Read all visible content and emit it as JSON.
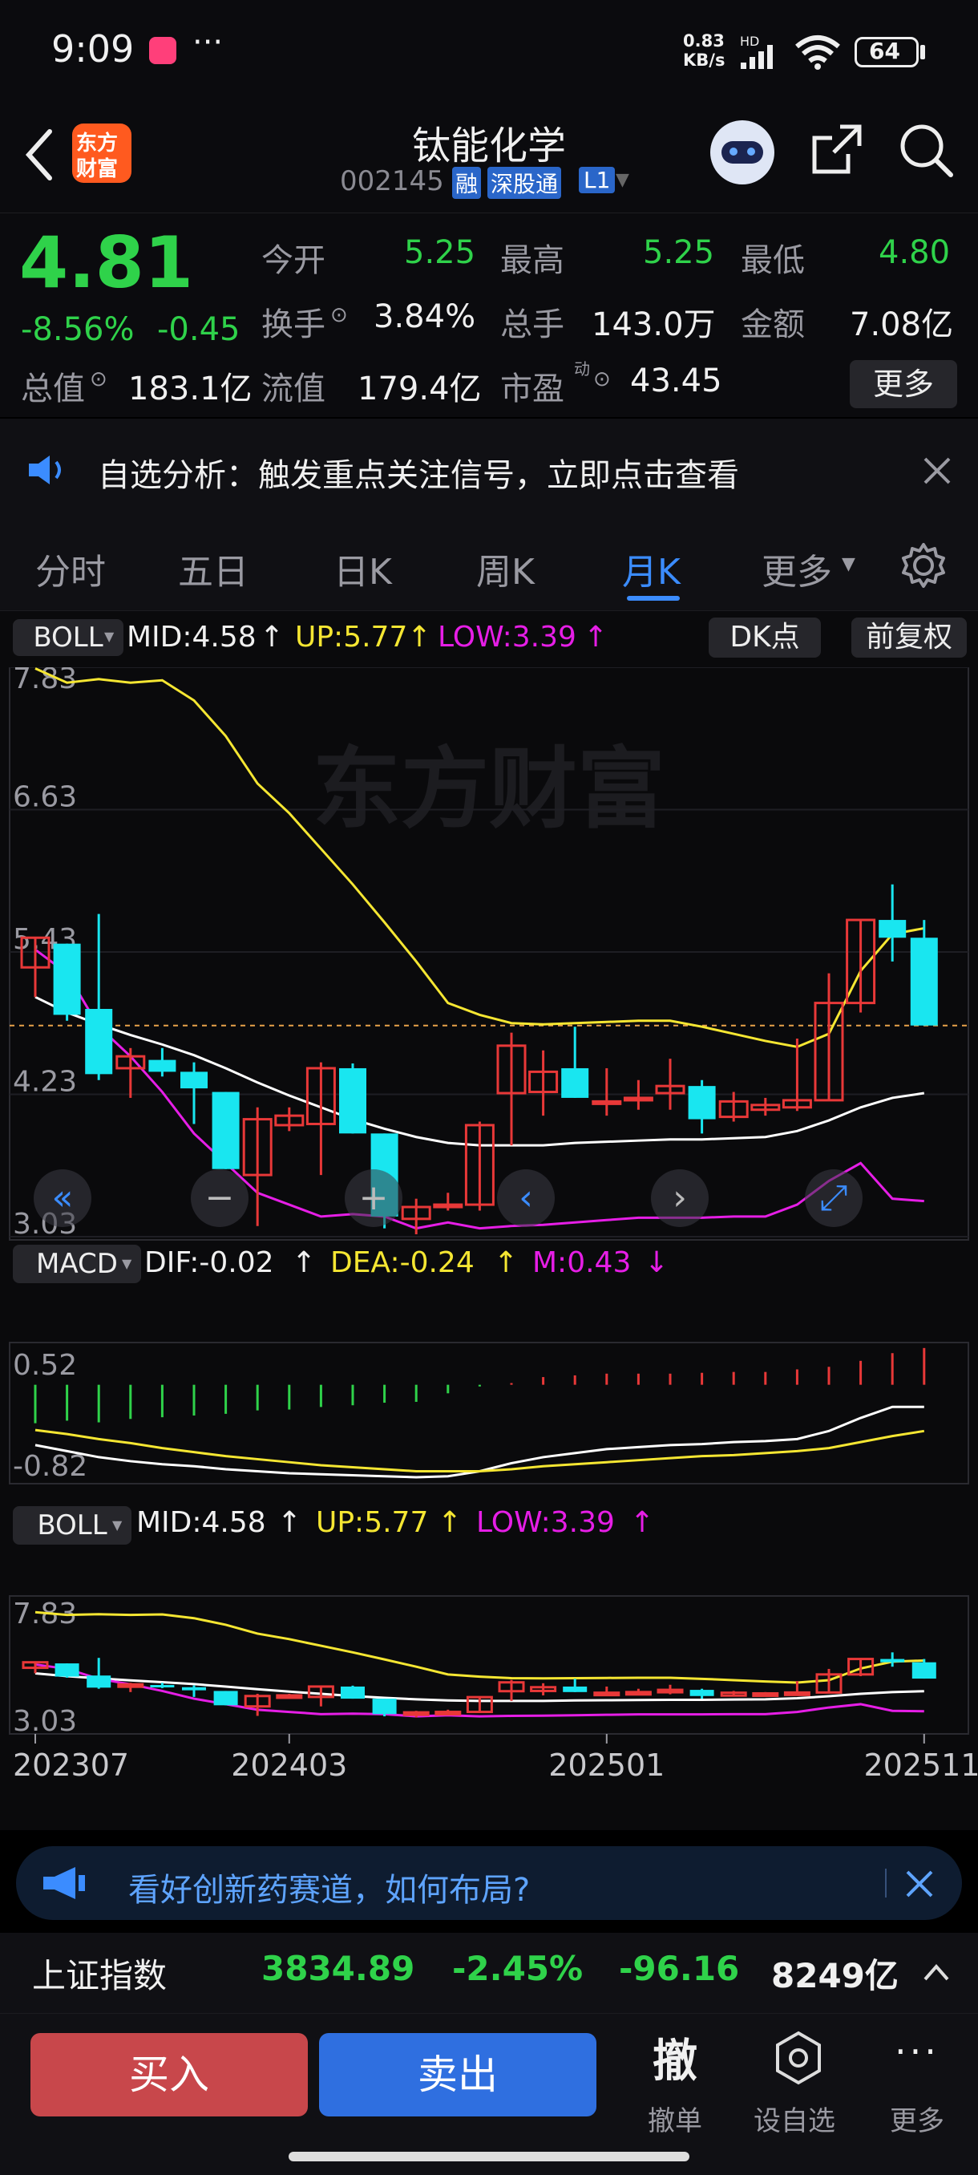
{
  "status": {
    "time": "9:09",
    "dots": "···",
    "net_speed_value": "0.83",
    "net_speed_unit": "KB/s",
    "net_type": "HD",
    "battery": "64"
  },
  "header": {
    "title": "钛能化学",
    "code": "002145",
    "tags": [
      "融",
      "深股通",
      "L1"
    ],
    "logo_text_1": "东方",
    "logo_text_2": "财富"
  },
  "quote": {
    "price": "4.81",
    "change_pct": "-8.56%",
    "change": "-0.45",
    "open_label": "今开",
    "open": "5.25",
    "high_label": "最高",
    "high": "5.25",
    "low_label": "最低",
    "low": "4.80",
    "turnover_label": "换手",
    "turnover": "3.84%",
    "volume_label": "总手",
    "volume": "143.0万",
    "amount_label": "金额",
    "amount": "7.08亿",
    "mcap_label": "总值",
    "mcap": "183.1亿",
    "float_label": "流值",
    "float": "179.4亿",
    "pe_label": "市盈",
    "pe_sup": "动",
    "pe": "43.45",
    "more": "更多"
  },
  "notice": {
    "text": "自选分析：触发重点关注信号，立即点击查看"
  },
  "tabs": [
    "分时",
    "五日",
    "日K",
    "周K",
    "月K",
    "更多"
  ],
  "active_tab": "月K",
  "chart": {
    "boll": {
      "name": "BOLL",
      "mid": "MID:4.58",
      "up": "UP:5.77",
      "low": "LOW:3.39",
      "arrow": "↑"
    },
    "dk_button": "DK点",
    "fq_button": "前复权",
    "watermark": "东方财富",
    "macd": {
      "name": "MACD",
      "dif": "DIF:-0.02",
      "dea": "DEA:-0.24",
      "m": "M:0.43",
      "up": "↑",
      "down": "↓"
    },
    "macd_axis": [
      "0.52",
      "-0.82"
    ],
    "x_labels": [
      "202307",
      "202403",
      "202501",
      "202511"
    ],
    "colors": {
      "up": "#e83838",
      "down": "#19e6f0",
      "mid": "#ffffff",
      "upper": "#f5e632",
      "lower": "#e61ee6",
      "macd_pos": "#e83838",
      "macd_neg": "#2fd24a"
    }
  },
  "chart_data": {
    "type": "candlestick",
    "y_ticks": [
      "7.83",
      "6.63",
      "5.43",
      "4.23",
      "3.03"
    ],
    "ylim": [
      3.03,
      7.83
    ],
    "mini_y_ticks": [
      "7.83",
      "3.03"
    ],
    "candles": [
      {
        "o": 5.3,
        "h": 5.55,
        "l": 5.05,
        "c": 5.55
      },
      {
        "o": 5.5,
        "h": 5.5,
        "l": 4.85,
        "c": 4.9
      },
      {
        "o": 4.95,
        "h": 5.75,
        "l": 4.35,
        "c": 4.4
      },
      {
        "o": 4.45,
        "h": 4.62,
        "l": 4.2,
        "c": 4.55
      },
      {
        "o": 4.52,
        "h": 4.62,
        "l": 4.38,
        "c": 4.42
      },
      {
        "o": 4.42,
        "h": 4.5,
        "l": 3.98,
        "c": 4.28
      },
      {
        "o": 4.25,
        "h": 4.25,
        "l": 3.6,
        "c": 3.6
      },
      {
        "o": 3.55,
        "h": 4.12,
        "l": 3.12,
        "c": 4.02
      },
      {
        "o": 3.97,
        "h": 4.12,
        "l": 3.92,
        "c": 4.05
      },
      {
        "o": 3.98,
        "h": 4.5,
        "l": 3.55,
        "c": 4.45
      },
      {
        "o": 4.45,
        "h": 4.49,
        "l": 3.9,
        "c": 3.9
      },
      {
        "o": 3.9,
        "h": 3.9,
        "l": 3.1,
        "c": 3.2
      },
      {
        "o": 3.18,
        "h": 3.35,
        "l": 3.05,
        "c": 3.28
      },
      {
        "o": 3.3,
        "h": 3.4,
        "l": 3.25,
        "c": 3.3
      },
      {
        "o": 3.3,
        "h": 4.0,
        "l": 3.25,
        "c": 3.97
      },
      {
        "o": 4.24,
        "h": 4.75,
        "l": 3.8,
        "c": 4.64
      },
      {
        "o": 4.25,
        "h": 4.6,
        "l": 4.05,
        "c": 4.42
      },
      {
        "o": 4.45,
        "h": 4.8,
        "l": 4.2,
        "c": 4.2
      },
      {
        "o": 4.17,
        "h": 4.45,
        "l": 4.05,
        "c": 4.17
      },
      {
        "o": 4.2,
        "h": 4.35,
        "l": 4.1,
        "c": 4.2
      },
      {
        "o": 4.24,
        "h": 4.53,
        "l": 4.1,
        "c": 4.3
      },
      {
        "o": 4.3,
        "h": 4.35,
        "l": 3.9,
        "c": 4.02
      },
      {
        "o": 4.04,
        "h": 4.25,
        "l": 4.0,
        "c": 4.17
      },
      {
        "o": 4.1,
        "h": 4.2,
        "l": 4.05,
        "c": 4.14
      },
      {
        "o": 4.12,
        "h": 4.7,
        "l": 4.09,
        "c": 4.18
      },
      {
        "o": 4.18,
        "h": 5.25,
        "l": 4.18,
        "c": 5.0
      },
      {
        "o": 5.0,
        "h": 5.7,
        "l": 4.92,
        "c": 5.7
      },
      {
        "o": 5.7,
        "h": 6.0,
        "l": 5.35,
        "c": 5.55
      },
      {
        "o": 5.55,
        "h": 5.7,
        "l": 4.81,
        "c": 4.81
      }
    ],
    "boll_mid": [
      5.05,
      4.92,
      4.82,
      4.73,
      4.65,
      4.56,
      4.45,
      4.33,
      4.22,
      4.12,
      4.02,
      3.94,
      3.87,
      3.82,
      3.8,
      3.8,
      3.8,
      3.82,
      3.83,
      3.84,
      3.85,
      3.85,
      3.86,
      3.87,
      3.92,
      4.01,
      4.12,
      4.2,
      4.24
    ],
    "boll_upper": [
      7.82,
      7.7,
      7.73,
      7.7,
      7.72,
      7.55,
      7.25,
      6.85,
      6.6,
      6.3,
      6.0,
      5.68,
      5.35,
      5.0,
      4.9,
      4.83,
      4.82,
      4.83,
      4.84,
      4.85,
      4.85,
      4.8,
      4.74,
      4.68,
      4.63,
      4.74,
      5.27,
      5.58,
      5.63
    ],
    "boll_lower": [
      5.45,
      5.25,
      4.8,
      4.55,
      4.25,
      3.9,
      3.65,
      3.4,
      3.3,
      3.2,
      3.22,
      3.2,
      3.1,
      3.15,
      3.1,
      3.12,
      3.13,
      3.15,
      3.17,
      3.19,
      3.19,
      3.19,
      3.2,
      3.2,
      3.3,
      3.5,
      3.65,
      3.35,
      3.33
    ],
    "macd": {
      "ylim": [
        -0.82,
        0.52
      ],
      "dif": [
        -0.5,
        -0.56,
        -0.62,
        -0.66,
        -0.69,
        -0.71,
        -0.74,
        -0.76,
        -0.78,
        -0.79,
        -0.8,
        -0.81,
        -0.82,
        -0.81,
        -0.76,
        -0.68,
        -0.62,
        -0.58,
        -0.54,
        -0.52,
        -0.5,
        -0.49,
        -0.47,
        -0.46,
        -0.44,
        -0.36,
        -0.23,
        -0.12,
        -0.12
      ],
      "dea": [
        -0.35,
        -0.39,
        -0.44,
        -0.48,
        -0.53,
        -0.57,
        -0.61,
        -0.64,
        -0.67,
        -0.7,
        -0.72,
        -0.74,
        -0.76,
        -0.76,
        -0.76,
        -0.74,
        -0.71,
        -0.69,
        -0.67,
        -0.65,
        -0.63,
        -0.61,
        -0.6,
        -0.58,
        -0.56,
        -0.53,
        -0.47,
        -0.41,
        -0.36
      ],
      "m": [
        -0.45,
        -0.42,
        -0.44,
        -0.4,
        -0.38,
        -0.36,
        -0.34,
        -0.3,
        -0.29,
        -0.26,
        -0.24,
        -0.21,
        -0.2,
        -0.1,
        -0.02,
        0.02,
        0.09,
        0.11,
        0.13,
        0.13,
        0.13,
        0.14,
        0.15,
        0.15,
        0.18,
        0.21,
        0.28,
        0.37,
        0.43
      ]
    }
  },
  "ad": {
    "text": "看好创新药赛道，如何布局?"
  },
  "index": {
    "name": "上证指数",
    "value": "3834.89",
    "pct": "-2.45%",
    "change": "-96.16",
    "amount": "8249亿"
  },
  "bottom": {
    "buy": "买入",
    "sell": "卖出",
    "cancel_glyph": "撤",
    "cancel": "撤单",
    "watch": "设自选",
    "more": "更多"
  }
}
